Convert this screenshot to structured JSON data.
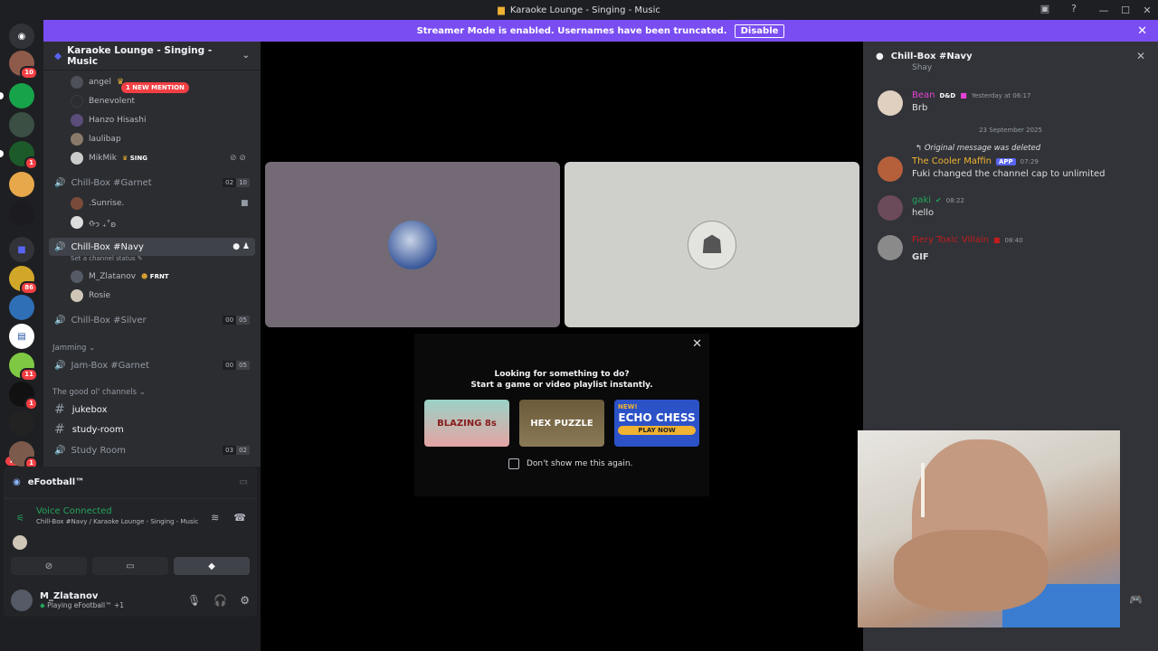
{
  "window": {
    "title": "Karaoke Lounge - Singing - Music"
  },
  "streamer": {
    "text": "Streamer Mode is enabled. Usernames have been truncated.",
    "button": "Disable"
  },
  "servers": {
    "badges": [
      "10",
      "1",
      "86",
      "11",
      "1",
      "1"
    ],
    "new_label": "NEW"
  },
  "sidebar": {
    "server_name": "Karaoke Lounge - Singing - Music",
    "mention_pill": "1 NEW MENTION",
    "users_top": [
      {
        "name": "angel"
      },
      {
        "name": "Benevolent"
      },
      {
        "name": "Hanzo Hisashi"
      },
      {
        "name": "laulibap"
      },
      {
        "name": "MikMik",
        "tag": "SING"
      }
    ],
    "garnet": {
      "name": "Chill-Box #Garnet",
      "c1": "02",
      "c2": "10",
      "users": [
        ".Sunrise.",
        "ᡣ𐭩 ₊˚ʚ"
      ]
    },
    "navy": {
      "name": "Chill-Box #Navy",
      "status": "Set a channel status",
      "users": [
        {
          "name": "M_Zlatanov",
          "tag": "FRNT"
        },
        {
          "name": "Rosie"
        }
      ]
    },
    "silver": {
      "name": "Chill-Box #Silver",
      "c1": "00",
      "c2": "05"
    },
    "cat_jamming": "Jamming",
    "jam": {
      "name": "Jam-Box #Garnet",
      "c1": "00",
      "c2": "05"
    },
    "cat_good": "The good ol' channels",
    "text_channels": [
      "jukebox",
      "study-room"
    ],
    "study": {
      "name": "Study Room",
      "c1": "03",
      "c2": "02"
    }
  },
  "panel": {
    "activity": "eFootball™",
    "voice_title": "Voice Connected",
    "voice_sub": "Chill-Box #Navy / Karaoke Lounge - Singing - Music",
    "user_name": "M_Zlatanov",
    "user_status": "Playing eFootball™ +1"
  },
  "activity_card": {
    "line1": "Looking for something to do?",
    "line2": "Start a game or video playlist instantly.",
    "games": [
      "BLAZING 8s",
      "HEX PUZZLE",
      "ECHO CHESS"
    ],
    "play_now": "PLAY NOW",
    "new_tag": "NEW!",
    "dont_show": "Don't show me this again."
  },
  "chat": {
    "title": "Chill-Box #Navy",
    "top_fragment": "Shay",
    "messages": [
      {
        "author": "Bean",
        "author_color": "#e542d6",
        "tag": "D&D",
        "time": "Yesterday at 06:17",
        "body": "Brb"
      },
      {
        "author": "The Cooler Maffin",
        "author_color": "#f0b232",
        "app": "APP",
        "time": "07:29",
        "body": "Fuki changed the channel cap to unlimited"
      },
      {
        "author": "gaki",
        "author_color": "#23a55a",
        "time": "08:22",
        "body": "hello"
      },
      {
        "author": "Fiery Toxic Villain",
        "author_color": "#c21d1d",
        "time": "08:40",
        "body": "GIF"
      }
    ],
    "date_sep": "23 September 2025",
    "reply_note": "Original message was deleted"
  }
}
